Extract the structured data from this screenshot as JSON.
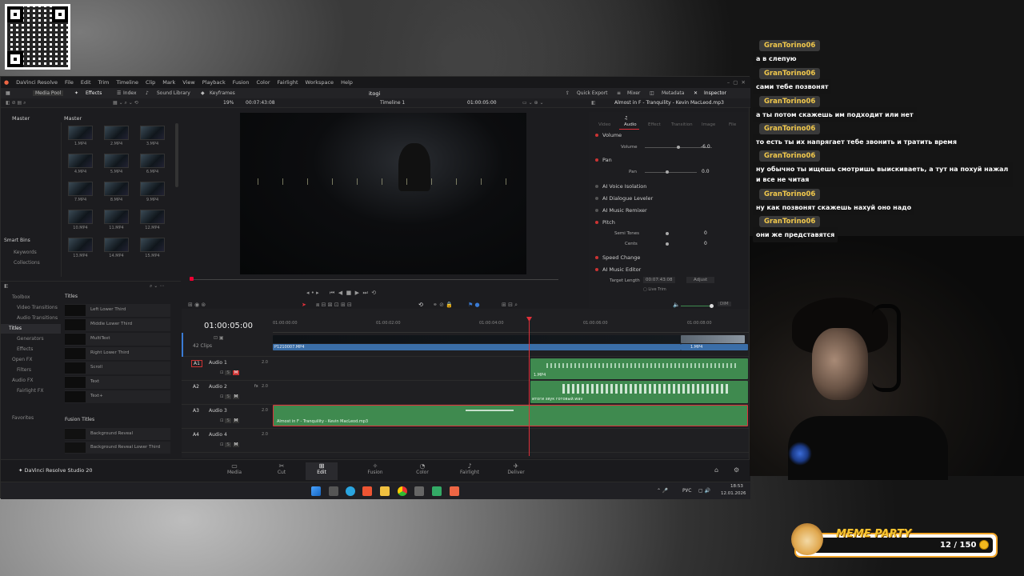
{
  "app": {
    "title": "DaVinci Resolve",
    "menu": [
      "Edit",
      "Trim",
      "Timeline",
      "Clip",
      "Mark",
      "View",
      "Playback",
      "Fusion",
      "Color",
      "Fairlight",
      "Workspace",
      "Help"
    ],
    "file_menu": "File",
    "project_name": "itogi",
    "toolbar": {
      "media_pool": "Media Pool",
      "effects": "Effects",
      "index": "Index",
      "sound_library": "Sound Library",
      "keyframes": "Keyframes",
      "quick_export": "Quick Export",
      "mixer": "Mixer",
      "metadata": "Metadata",
      "inspector": "Inspector"
    },
    "sub": {
      "zoom": "19%",
      "source_tc": "00:07:43:08",
      "timeline_name": "Timeline 1",
      "record_tc": "01:00:05:00",
      "clip_title": "Almost in F - Tranquility - Kevin MacLeod.mp3"
    },
    "media_pool": {
      "bin_left": "Master",
      "bin_right": "Master",
      "smart_bins": "Smart Bins",
      "keywords": "Keywords",
      "collections": "Collections",
      "clips": [
        "1.MP4",
        "2.MP4",
        "3.MP4",
        "4.MP4",
        "5.MP4",
        "6.MP4",
        "7.MP4",
        "8.MP4",
        "9.MP4",
        "10.MP4",
        "11.MP4",
        "12.MP4",
        "13.MP4",
        "14.MP4",
        "15.MP4"
      ]
    },
    "effects": {
      "toolbox": "Toolbox",
      "video_transitions": "Video Transitions",
      "audio_transitions": "Audio Transitions",
      "titles": "Titles",
      "generators": "Generators",
      "effects": "Effects",
      "open_fx": "Open FX",
      "filters": "Filters",
      "audio_fx": "Audio FX",
      "fairlight_fx": "Fairlight FX",
      "favorites": "Favorites",
      "titles_header": "Titles",
      "title_items": [
        "Left Lower Third",
        "Middle Lower Third",
        "MultiText",
        "Right Lower Third",
        "Scroll",
        "Text",
        "Text+"
      ],
      "fusion_titles_header": "Fusion Titles",
      "fusion_items": [
        "Background Reveal",
        "Background Reveal Lower Third"
      ]
    },
    "inspector": {
      "tabs": [
        "Video",
        "Audio",
        "Effect",
        "Transition",
        "Image",
        "File"
      ],
      "volume": "Volume",
      "volume_label": "Volume",
      "volume_value": "-6.0",
      "pan": "Pan",
      "pan_label": "Pan",
      "pan_value": "0.0",
      "ai_voice": "AI Voice Isolation",
      "ai_dialogue": "AI Dialogue Leveler",
      "ai_music": "AI Music Remixer",
      "pitch": "Pitch",
      "semitones": "Semi Tones",
      "semitones_value": "0",
      "cents": "Cents",
      "cents_value": "0",
      "speed_change": "Speed Change",
      "ai_music_editor": "AI Music Editor",
      "target_length": "Target Length",
      "target_value": "00:07:43:08",
      "adjust": "Adjust",
      "live_trim": "Live Trim"
    },
    "timeline": {
      "tc": "01:00:05:00",
      "ruler": [
        "01:00:00:00",
        "01:00:02:00",
        "01:00:04:00",
        "01:00:06:00",
        "01:00:08:00"
      ],
      "clip_count": "42 Clips",
      "video_clip1": "P1210007.MP4",
      "video_clip2": "1.MP4",
      "audio_clip_a1": "1.MP4",
      "audio_clip_a2": "итоги звук готовый.wav",
      "audio_clip_a3": "Almost in F - Tranquility - Kevin MacLeod.mp3",
      "tracks": [
        {
          "id": "A1",
          "name": "Audio 1",
          "ch": "2.0"
        },
        {
          "id": "A2",
          "name": "Audio 2",
          "ch": "2.0",
          "fx": "fx"
        },
        {
          "id": "A3",
          "name": "Audio 3",
          "ch": "2.0"
        },
        {
          "id": "A4",
          "name": "Audio 4",
          "ch": "2.0"
        }
      ],
      "dim": "DIM"
    },
    "pages": [
      "Media",
      "Cut",
      "Edit",
      "Fusion",
      "Color",
      "Fairlight",
      "Deliver"
    ],
    "brand": "DaVinci Resolve Studio 20",
    "taskbar": {
      "lang": "РУС",
      "time": "18:53",
      "date": "12.01.2026"
    }
  },
  "chat": [
    {
      "user": "GranTorino06",
      "text": "а в слепую"
    },
    {
      "user": "GranTorino06",
      "text": "сами тебе позвонят"
    },
    {
      "user": "GranTorino06",
      "text": "а ты потом скажешь им подходит или нет"
    },
    {
      "user": "GranTorino06",
      "text": "то есть ты их напрягает тебе звонить и тратить время"
    },
    {
      "user": "GranTorino06",
      "text": "ну обычно ты ищешь смотришь выискиваеть, а тут на похуй нажал и все не читая"
    },
    {
      "user": "GranTorino06",
      "text": "ну как позвонят скажешь нахуй оно надо"
    },
    {
      "user": "GranTorino06",
      "text": "они же представятся"
    }
  ],
  "meme_party": {
    "title": "MEME PARTY",
    "count": "12 / 150",
    "progress": 0.08
  },
  "colors": {
    "accent_red": "#e0303a",
    "audio_green": "#3f8a4f",
    "video_blue": "#3a6ea8",
    "chat_name": "#f2c94c"
  }
}
